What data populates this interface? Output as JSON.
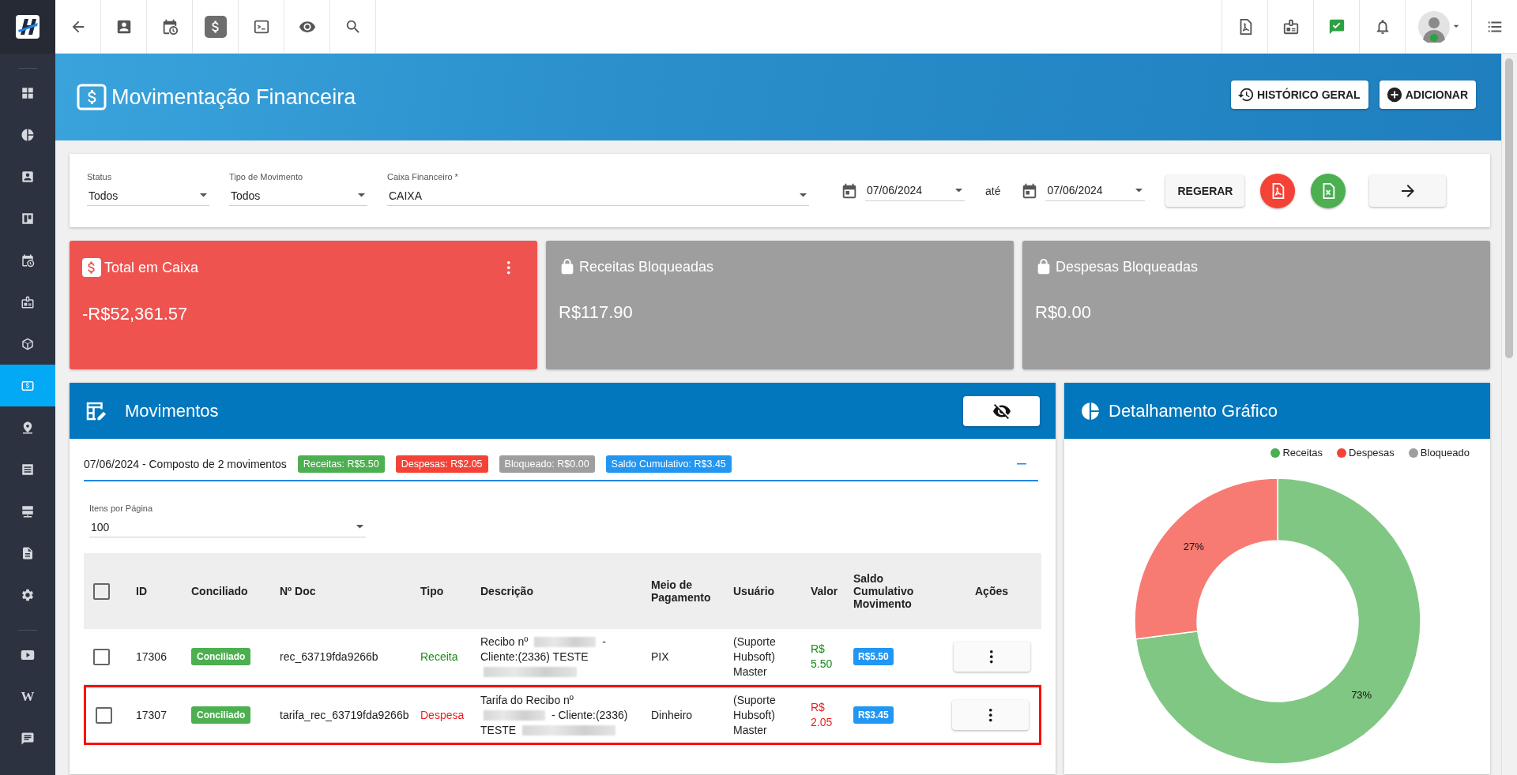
{
  "sidebar": {
    "items": [
      {
        "selected": false
      },
      {
        "selected": false
      },
      {
        "selected": false
      },
      {
        "selected": false
      },
      {
        "selected": false
      },
      {
        "selected": false
      },
      {
        "selected": false
      },
      {
        "selected": true
      },
      {
        "selected": false
      },
      {
        "selected": false
      },
      {
        "selected": false
      },
      {
        "selected": false
      },
      {
        "selected": false
      },
      {
        "selected": false
      },
      {
        "label": "W",
        "selected": false
      },
      {
        "selected": false
      }
    ]
  },
  "toolbar": {
    "items": [
      {
        "selected": false
      },
      {
        "selected": false
      },
      {
        "selected": false
      },
      {
        "selected": true
      },
      {
        "selected": false
      },
      {
        "selected": false
      },
      {
        "selected": false
      }
    ]
  },
  "header": {
    "title": "Movimentação Financeira",
    "buttons": [
      "HISTÓRICO GERAL",
      "ADICIONAR"
    ]
  },
  "filters": {
    "fields": [
      {
        "label": "Status",
        "value": "Todos"
      },
      {
        "label": "Tipo de Movimento",
        "value": "Todos"
      },
      {
        "label": "Caixa Financeiro *",
        "value": "CAIXA"
      }
    ],
    "date_from": "07/06/2024",
    "date_separator": "até",
    "date_to": "07/06/2024",
    "regen_button": "REGERAR"
  },
  "stats": [
    {
      "kind": "total",
      "title": "Total em Caixa",
      "value": "-R$52,361.57",
      "color": "#ef5350"
    },
    {
      "kind": "locked",
      "title": "Receitas Bloqueadas",
      "value": "R$117.90",
      "color": "#9e9e9e"
    },
    {
      "kind": "locked",
      "title": "Despesas Bloqueadas",
      "value": "R$0.00",
      "color": "#9e9e9e"
    }
  ],
  "movimentos": {
    "title": "Movimentos",
    "summary": "07/06/2024 - Composto de 2 movimentos",
    "expanded": true,
    "chips": [
      {
        "text": "Receitas: R$5.50",
        "color": "#4caf50"
      },
      {
        "text": "Despesas: R$2.05",
        "color": "#f44336"
      },
      {
        "text": "Bloqueado: R$0.00",
        "color": "#9e9e9e"
      },
      {
        "text": "Saldo Cumulativo: R$3.45",
        "color": "#2196f3"
      }
    ],
    "per_page": {
      "label": "Itens por Página",
      "value": "100"
    },
    "table": {
      "all_checked": false,
      "columns": [
        "ID",
        "Conciliado",
        "Nº Doc",
        "Tipo",
        "Descrição",
        "Meio de Pagamento",
        "Usuário",
        "Valor",
        "Saldo Cumulativo Movimento",
        "Ações"
      ],
      "rows": [
        {
          "checked": false,
          "highlighted": false,
          "id": "17306",
          "status": "Conciliado",
          "doc": "rec_63719fda9266b",
          "type": "Receita",
          "color": "#188a18",
          "description": [
            {
              "kind": "text",
              "text": "Recibo nº"
            },
            {
              "kind": "blur"
            },
            {
              "kind": "text",
              "text": "-"
            },
            {
              "kind": "text",
              "text": "Cliente:(2336) TESTE"
            },
            {
              "kind": "blur"
            }
          ],
          "payment": "PIX",
          "user": "(Suporte Hubsoft) Master",
          "value": "R$ 5.50",
          "balance": "R$5.50"
        },
        {
          "checked": false,
          "highlighted": true,
          "id": "17307",
          "status": "Conciliado",
          "doc": "tarifa_rec_63719fda9266b",
          "type": "Despesa",
          "color": "#f01e1e",
          "description": [
            {
              "kind": "text",
              "text": "Tarifa do Recibo nº"
            },
            {
              "kind": "blur"
            },
            {
              "kind": "text",
              "text": "- Cliente:(2336)"
            },
            {
              "kind": "text",
              "text": "TESTE"
            },
            {
              "kind": "blur"
            }
          ],
          "payment": "Dinheiro",
          "user": "(Suporte Hubsoft) Master",
          "value": "R$ 2.05",
          "balance": "R$3.45"
        }
      ]
    }
  },
  "chart_panel": {
    "title": "Detalhamento Gráfico",
    "chart_data": {
      "type": "donut",
      "categories": [
        "Receitas",
        "Despesas",
        "Bloqueado"
      ],
      "colors": [
        "#4caf50",
        "#f44336",
        "#9e9e9e"
      ],
      "values": [
        73,
        27,
        0
      ],
      "legend": "top",
      "value_labels": [
        "73%",
        "27%",
        null
      ]
    }
  }
}
